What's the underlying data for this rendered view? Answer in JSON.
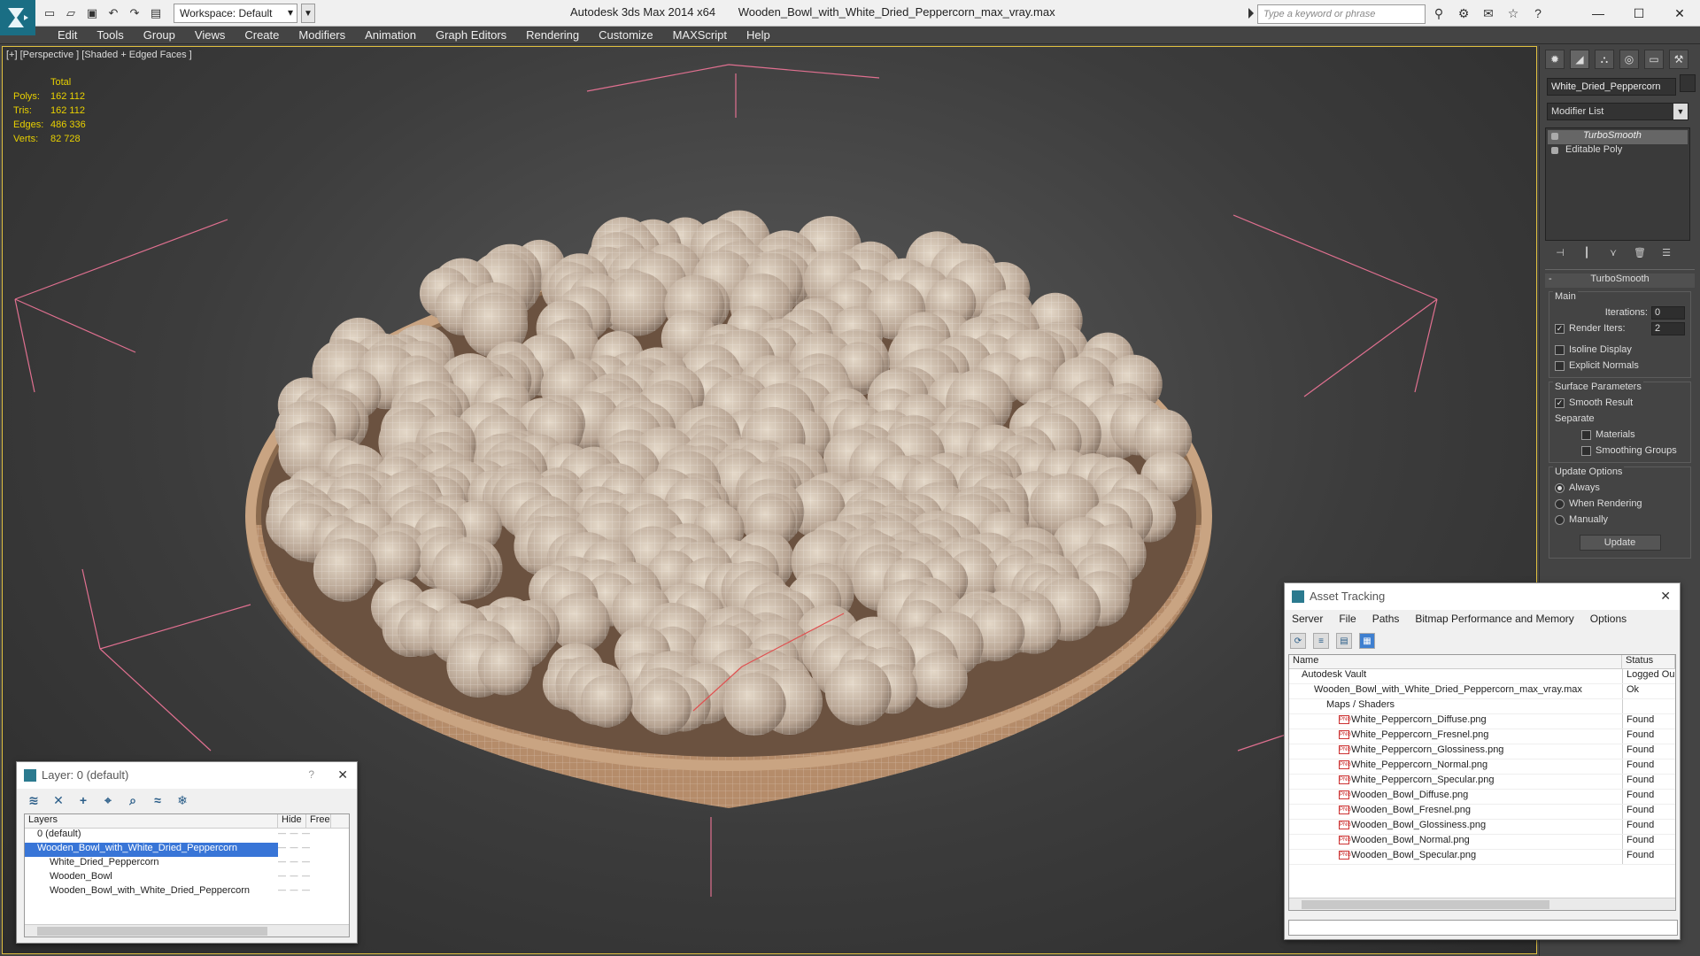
{
  "window": {
    "app_name": "Autodesk 3ds Max  2014 x64",
    "file_name": "Wooden_Bowl_with_White_Dried_Peppercorn_max_vray.max",
    "workspace": "Workspace: Default",
    "search_placeholder": "Type a keyword or phrase"
  },
  "menu": [
    "Edit",
    "Tools",
    "Group",
    "Views",
    "Create",
    "Modifiers",
    "Animation",
    "Graph Editors",
    "Rendering",
    "Customize",
    "MAXScript",
    "Help"
  ],
  "viewport": {
    "label": "[+] [Perspective ] [Shaded + Edged Faces ]",
    "stats": {
      "header": "Total",
      "rows": [
        {
          "label": "Polys:",
          "value": "162 112"
        },
        {
          "label": "Tris:",
          "value": "162 112"
        },
        {
          "label": "Edges:",
          "value": "486 336"
        },
        {
          "label": "Verts:",
          "value": "82 728"
        }
      ]
    }
  },
  "command_panel": {
    "object_name": "White_Dried_Peppercorn",
    "modifier_list": "Modifier List",
    "stack": [
      "TurboSmooth",
      "Editable Poly"
    ],
    "rollout_title": "TurboSmooth",
    "main_group": "Main",
    "iterations_label": "Iterations:",
    "iterations_value": "0",
    "render_iters_label": "Render Iters:",
    "render_iters_value": "2",
    "isoline_display": "Isoline Display",
    "explicit_normals": "Explicit Normals",
    "surface_group": "Surface Parameters",
    "smooth_result": "Smooth Result",
    "separate": "Separate",
    "materials": "Materials",
    "smoothing_groups": "Smoothing Groups",
    "update_group": "Update Options",
    "always": "Always",
    "when_rendering": "When Rendering",
    "manually": "Manually",
    "update_button": "Update"
  },
  "layer_dialog": {
    "title": "Layer: 0 (default)",
    "col_layers": "Layers",
    "col_hide": "Hide",
    "col_freeze": "Free",
    "rows": [
      {
        "name": "0 (default)",
        "indent": 1
      },
      {
        "name": "Wooden_Bowl_with_White_Dried_Peppercorn",
        "indent": 1
      },
      {
        "name": "White_Dried_Peppercorn",
        "indent": 2
      },
      {
        "name": "Wooden_Bowl",
        "indent": 2
      },
      {
        "name": "Wooden_Bowl_with_White_Dried_Peppercorn",
        "indent": 2
      }
    ]
  },
  "asset_dialog": {
    "title": "Asset Tracking",
    "menu": [
      "Server",
      "File",
      "Paths",
      "Bitmap Performance and Memory",
      "Options"
    ],
    "col_name": "Name",
    "col_status": "Status",
    "rows": [
      {
        "name": "Autodesk Vault",
        "status": "Logged Ou",
        "indent": 1
      },
      {
        "name": "Wooden_Bowl_with_White_Dried_Peppercorn_max_vray.max",
        "status": "Ok",
        "indent": 2
      },
      {
        "name": "Maps / Shaders",
        "status": "",
        "indent": 3
      },
      {
        "name": "White_Peppercorn_Diffuse.png",
        "status": "Found",
        "indent": 4
      },
      {
        "name": "White_Peppercorn_Fresnel.png",
        "status": "Found",
        "indent": 4
      },
      {
        "name": "White_Peppercorn_Glossiness.png",
        "status": "Found",
        "indent": 4
      },
      {
        "name": "White_Peppercorn_Normal.png",
        "status": "Found",
        "indent": 4
      },
      {
        "name": "White_Peppercorn_Specular.png",
        "status": "Found",
        "indent": 4
      },
      {
        "name": "Wooden_Bowl_Diffuse.png",
        "status": "Found",
        "indent": 4
      },
      {
        "name": "Wooden_Bowl_Fresnel.png",
        "status": "Found",
        "indent": 4
      },
      {
        "name": "Wooden_Bowl_Glossiness.png",
        "status": "Found",
        "indent": 4
      },
      {
        "name": "Wooden_Bowl_Normal.png",
        "status": "Found",
        "indent": 4
      },
      {
        "name": "Wooden_Bowl_Specular.png",
        "status": "Found",
        "indent": 4
      }
    ]
  }
}
